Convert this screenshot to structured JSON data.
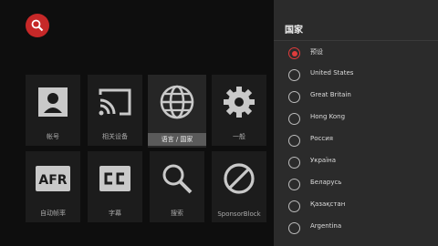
{
  "toolbar": {
    "search_icon": "search-icon",
    "accent": "#c62828"
  },
  "tiles": [
    {
      "label": "帐号",
      "icon": "account-icon"
    },
    {
      "label": "相关设备",
      "icon": "cast-icon"
    },
    {
      "label": "语言 / 国家",
      "icon": "globe-icon",
      "focused": true
    },
    {
      "label": "一般",
      "icon": "gear-icon"
    },
    {
      "label": "自动帧率",
      "icon": "afr-icon"
    },
    {
      "label": "字幕",
      "icon": "cc-icon"
    },
    {
      "label": "搜索",
      "icon": "search-icon"
    },
    {
      "label": "SponsorBlock",
      "icon": "block-icon"
    }
  ],
  "panel": {
    "title": "国家",
    "options": [
      {
        "label": "预设",
        "selected": true
      },
      {
        "label": "United States",
        "selected": false
      },
      {
        "label": "Great Britain",
        "selected": false
      },
      {
        "label": "Hong Kong",
        "selected": false
      },
      {
        "label": "Россия",
        "selected": false
      },
      {
        "label": "Україна",
        "selected": false
      },
      {
        "label": "Беларусь",
        "selected": false
      },
      {
        "label": "Қазақстан",
        "selected": false
      },
      {
        "label": "Argentina",
        "selected": false
      }
    ]
  }
}
